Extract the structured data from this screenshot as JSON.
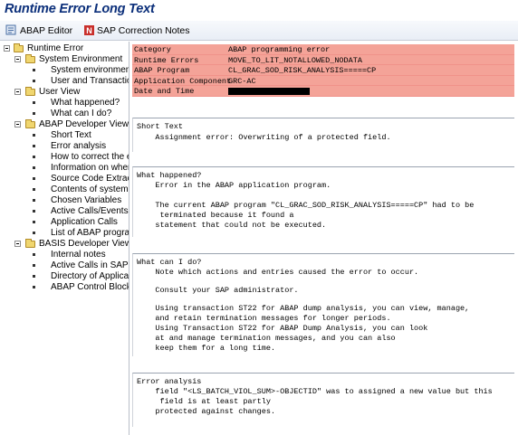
{
  "title": "Runtime Error Long Text",
  "toolbar": {
    "abap_editor": "ABAP Editor",
    "sap_notes": "SAP Correction Notes"
  },
  "tree": {
    "root": "Runtime Error",
    "system_env": "System Environment",
    "system_env_items": [
      "System environment",
      "User and Transaction"
    ],
    "user_view": "User View",
    "user_view_items": [
      "What happened?",
      "What can I do?"
    ],
    "dev_view": "ABAP Developer View",
    "dev_view_items": [
      "Short Text",
      "Error analysis",
      "How to correct the err",
      "Information on where t",
      "Source Code Extract",
      "Contents of system fiel",
      "Chosen Variables",
      "Active Calls/Events",
      "Application Calls",
      "List of ABAP programs a"
    ],
    "basis_view": "BASIS Developer View",
    "basis_view_items": [
      "Internal notes",
      "Active Calls in SAP Kern",
      "Directory of Application",
      "ABAP Control Blocks (C"
    ]
  },
  "header": {
    "category_label": "Category",
    "category_value": "ABAP programming error",
    "runtime_label": "Runtime Errors",
    "runtime_value": "MOVE_TO_LIT_NOTALLOWED_NODATA",
    "program_label": "ABAP Program",
    "program_value": "CL_GRAC_SOD_RISK_ANALYSIS=====CP",
    "component_label": "Application Component",
    "component_value": "GRC-AC",
    "date_label": "Date and Time"
  },
  "short_text": {
    "title": "Short Text",
    "lines": [
      "    Assignment error: Overwriting of a protected field."
    ]
  },
  "what_happened": {
    "title": "What happened?",
    "lines": [
      "    Error in the ABAP application program.",
      "",
      "    The current ABAP program \"CL_GRAC_SOD_RISK_ANALYSIS=====CP\" had to be",
      "     terminated because it found a",
      "    statement that could not be executed."
    ]
  },
  "what_can_i_do": {
    "title": "What can I do?",
    "lines": [
      "    Note which actions and entries caused the error to occur.",
      "",
      "    Consult your SAP administrator.",
      "",
      "    Using transaction ST22 for ABAP dump analysis, you can view, manage,",
      "    and retain termination messages for longer periods.",
      "    Using Transaction ST22 for ABAP Dump Analysis, you can look",
      "    at and manage termination messages, and you can also",
      "    keep them for a long time."
    ]
  },
  "error_analysis": {
    "title": "Error analysis",
    "lines": [
      "    field \"<LS_BATCH_VIOL_SUM>-OBJECTID\" was to assigned a new value but this",
      "     field is at least partly",
      "    protected against changes."
    ]
  },
  "colors": {
    "header_bg": "#f4a398",
    "title": "#0b2f7a",
    "folder": "#f0d66f"
  }
}
